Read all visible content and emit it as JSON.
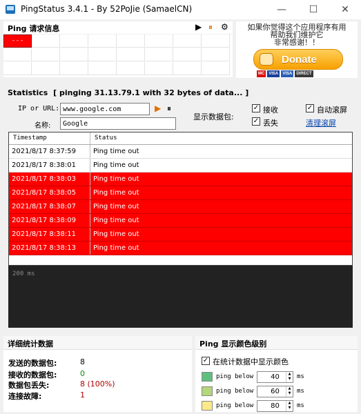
{
  "window": {
    "title": "PingStatus 3.4.1 - By 52PoJie (SamaelCN)",
    "minimize": "—",
    "maximize": "☐",
    "close": "✕"
  },
  "ping_grid": {
    "title": "Ping 请求信息",
    "play": "▶",
    "pause": "⏸",
    "settings": "⚙",
    "first_cell_text": "- - -"
  },
  "donate": {
    "text_line1": "如果你觉得这个应用程序有用",
    "text_line2": "帮助我们维护它",
    "text_line3": "非常感谢！！",
    "button_label": "Donate",
    "cards": [
      "VISA",
      "VISA",
      "DIRECT"
    ]
  },
  "statistics": {
    "title": "Statistics",
    "status": "[ pinging 31.13.79.1 with 32 bytes of data... ]",
    "ip_label": "IP or URL:",
    "ip_value": "www.google.com",
    "name_label": "名称:",
    "name_value": "Google",
    "show_packets_label": "显示数据包:",
    "receive_label": "接收",
    "lost_label": "丢失",
    "auto_scroll_label": "自动滚屏",
    "clear_log_label": "清理滚屏",
    "check_mark": "✓",
    "play": "▶",
    "pause": "⏸"
  },
  "log": {
    "headers": [
      "Timestamp",
      "Status"
    ],
    "rows": [
      {
        "ts": "2021/8/17  8:37:59",
        "status": "Ping time out",
        "red": false
      },
      {
        "ts": "2021/8/17  8:38:01",
        "status": "Ping time out",
        "red": false
      },
      {
        "ts": "2021/8/17  8:38:03",
        "status": "Ping time out",
        "red": true
      },
      {
        "ts": "2021/8/17  8:38:05",
        "status": "Ping time out",
        "red": true
      },
      {
        "ts": "2021/8/17  8:38:07",
        "status": "Ping time out",
        "red": true
      },
      {
        "ts": "2021/8/17  8:38:09",
        "status": "Ping time out",
        "red": true
      },
      {
        "ts": "2021/8/17  8:38:11",
        "status": "Ping time out",
        "red": true
      },
      {
        "ts": "2021/8/17  8:38:13",
        "status": "Ping time out",
        "red": true
      }
    ]
  },
  "graph": {
    "label": "200 ms"
  },
  "details": {
    "title": "详细统计数据",
    "sent_label": "发送的数据包:",
    "sent_value": "8",
    "received_label": "接收的数据包:",
    "received_value": "0",
    "lost_label": "数据包丢失:",
    "lost_value": "8 (100%)",
    "fail_label": "连接故障:",
    "fail_value": "1"
  },
  "color_levels": {
    "title": "Ping 显示颜色级别",
    "show_color_label": "在统计数据中显示颜色",
    "levels": [
      {
        "label": "ping below",
        "value": "40",
        "unit": "ms",
        "color": "#5fbf7f"
      },
      {
        "label": "ping below",
        "value": "60",
        "unit": "ms",
        "color": "#b5d67a"
      },
      {
        "label": "ping below",
        "value": "80",
        "unit": "ms",
        "color": "#fbe98a"
      }
    ]
  },
  "colors": {
    "alert_red": "#ff0000",
    "donate_orange": "#f7a000",
    "graph_bg": "#222222"
  }
}
